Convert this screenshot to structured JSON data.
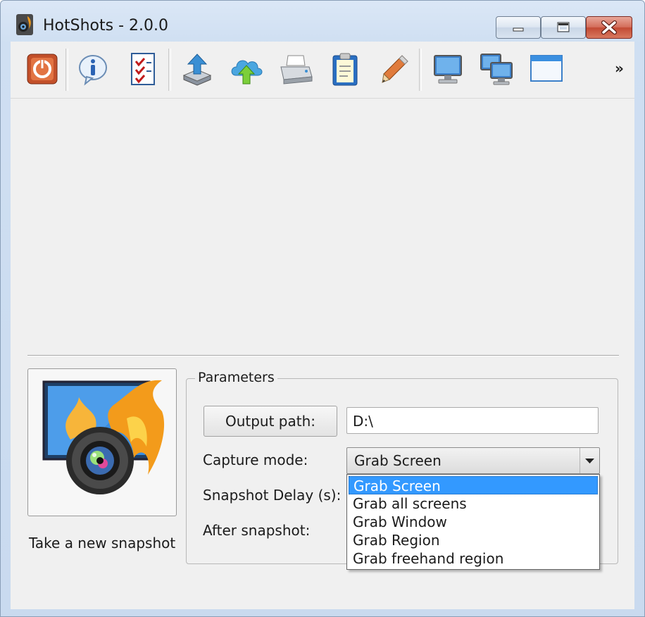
{
  "window": {
    "title": "HotShots - 2.0.0"
  },
  "toolbar": {
    "buttons": [
      "power-icon",
      "info-icon",
      "checklist-icon",
      "upload-icon",
      "cloud-upload-icon",
      "printer-icon",
      "clipboard-icon",
      "pencil-icon",
      "monitor-icon",
      "dual-monitor-icon",
      "window-icon"
    ],
    "overflow": "»"
  },
  "snapshot": {
    "label": "Take a new snapshot"
  },
  "parameters": {
    "legend": "Parameters",
    "output_path_button": "Output path:",
    "output_path_value": "D:\\",
    "capture_mode_label": "Capture mode:",
    "capture_mode_value": "Grab Screen",
    "snapshot_delay_label": "Snapshot Delay (s):",
    "after_snapshot_label": "After snapshot:"
  },
  "dropdown": {
    "selected_index": 0,
    "options": [
      "Grab Screen",
      "Grab all screens",
      "Grab Window",
      "Grab Region",
      "Grab freehand region"
    ]
  },
  "colors": {
    "selection": "#3399ff",
    "close_button": "#c24a34",
    "titlebar": "#dbe7f6"
  }
}
